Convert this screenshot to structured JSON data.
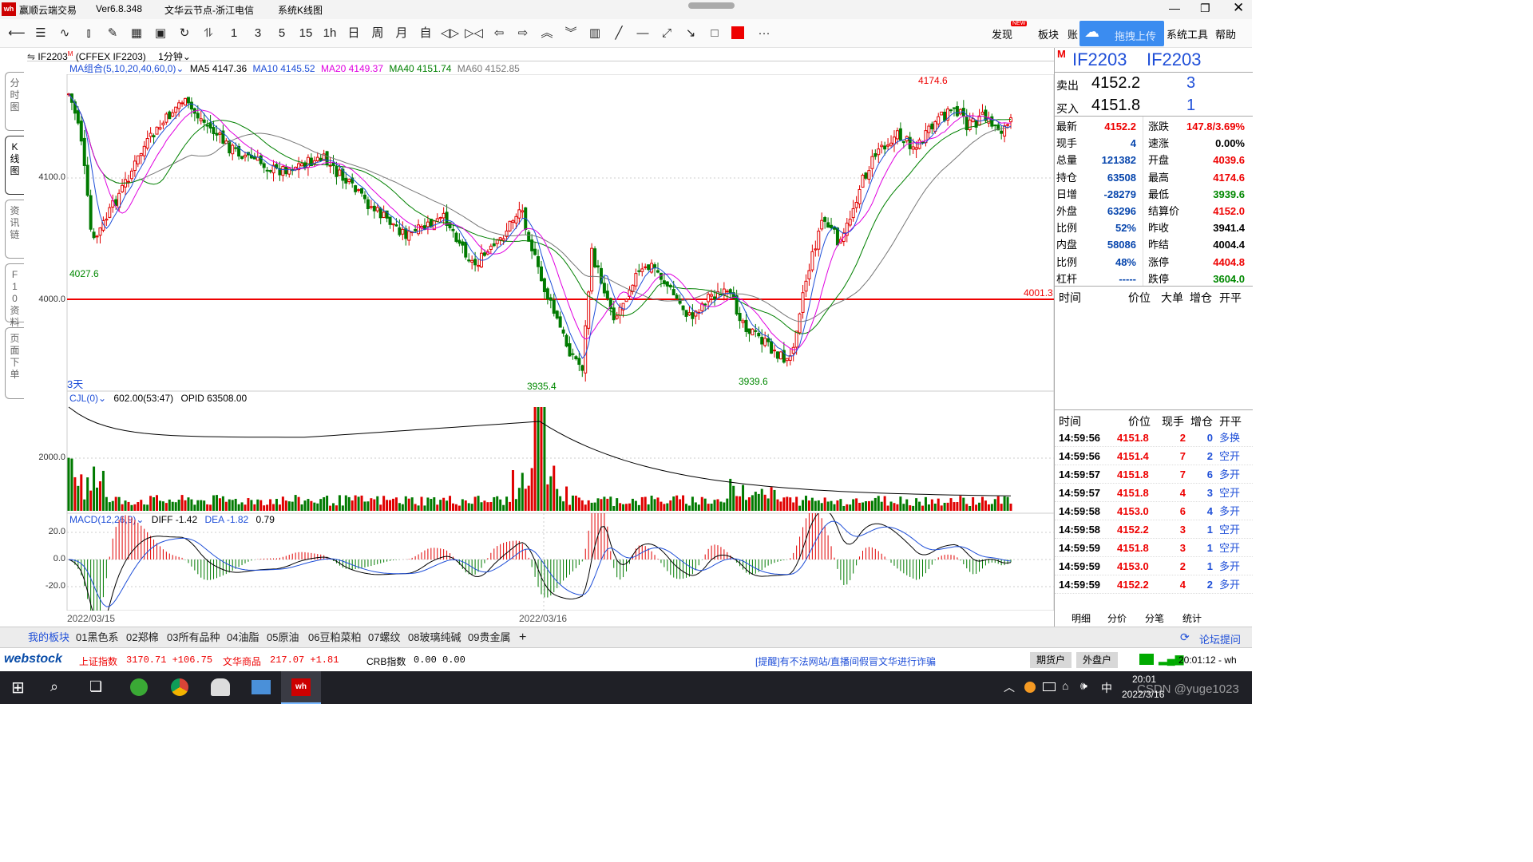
{
  "titlebar": {
    "app": "赢顺云端交易",
    "version": "Ver6.8.348",
    "server": "文华云节点-浙江电信",
    "view": "系统K线图"
  },
  "toolbar": {
    "periods": [
      "1",
      "3",
      "5",
      "15",
      "1h",
      "日",
      "周",
      "月",
      "自"
    ],
    "right_menu": [
      "发现",
      "板块",
      "账",
      "拖拽上传",
      "系统工具",
      "帮助"
    ],
    "new_badge": "NEW"
  },
  "chart_header": {
    "symbol": "IF2203",
    "market_flag": "M",
    "exchange": "(CFFEX IF2203)",
    "period": "1分钟"
  },
  "ma": {
    "label": "MA组合(5,10,20,40,60,0)",
    "ma5": "MA5 4147.36",
    "ma10": "MA10 4145.52",
    "ma20": "MA20 4149.37",
    "ma40": "MA40 4151.74",
    "ma60": "MA60 4152.85"
  },
  "price_axis": [
    "4100.0",
    "4000.0"
  ],
  "annotations": {
    "high": "4174.6",
    "low1": "4027.6",
    "low2": "3935.4",
    "low3": "3939.6",
    "hline": "4001.3",
    "days": "3天"
  },
  "volume": {
    "label": "CJL(0)",
    "value": "602.00(53:47)",
    "opid": "OPID 63508.00",
    "axis": "2000.0"
  },
  "macd": {
    "label": "MACD(12,26,9)",
    "diff": "DIFF -1.42",
    "dea": "DEA -1.82",
    "val": "0.79",
    "axis": [
      "20.0",
      "0.0",
      "-20.0"
    ]
  },
  "dates": [
    "2022/03/15",
    "2022/03/16"
  ],
  "sidetabs": [
    "分时图",
    "K线图",
    "资讯链",
    "F10资料",
    "页面下单"
  ],
  "quote": {
    "symbol": "IF2203",
    "symbol2": "IF2203",
    "flag": "M",
    "ask_label": "卖出",
    "ask": "4152.2",
    "ask_vol": "3",
    "bid_label": "买入",
    "bid": "4151.8",
    "bid_vol": "1",
    "rows": [
      {
        "l1": "最新",
        "v1": "4152.2",
        "c1": "#e00",
        "l2": "涨跌",
        "v2": "147.8/3.69%",
        "c2": "#e00"
      },
      {
        "l1": "现手",
        "v1": "4",
        "c1": "#0645ad",
        "l2": "速涨",
        "v2": "0.00%",
        "c2": "#000"
      },
      {
        "l1": "总量",
        "v1": "121382",
        "c1": "#0645ad",
        "l2": "开盘",
        "v2": "4039.6",
        "c2": "#e00"
      },
      {
        "l1": "持仓",
        "v1": "63508",
        "c1": "#0645ad",
        "l2": "最高",
        "v2": "4174.6",
        "c2": "#e00"
      },
      {
        "l1": "日增",
        "v1": "-28279",
        "c1": "#0645ad",
        "l2": "最低",
        "v2": "3939.6",
        "c2": "#080"
      },
      {
        "l1": "外盘",
        "v1": "63296",
        "c1": "#0645ad",
        "l2": "结算价",
        "v2": "4152.0",
        "c2": "#e00"
      },
      {
        "l1": "比例",
        "v1": "52%",
        "c1": "#0645ad",
        "l2": "昨收",
        "v2": "3941.4",
        "c2": "#000"
      },
      {
        "l1": "内盘",
        "v1": "58086",
        "c1": "#0645ad",
        "l2": "昨结",
        "v2": "4004.4",
        "c2": "#000"
      },
      {
        "l1": "比例",
        "v1": "48%",
        "c1": "#0645ad",
        "l2": "涨停",
        "v2": "4404.8",
        "c2": "#e00"
      },
      {
        "l1": "杠杆",
        "v1": "-----",
        "c1": "#0645ad",
        "l2": "跌停",
        "v2": "3604.0",
        "c2": "#080"
      }
    ],
    "col_headers": [
      "时间",
      "价位",
      "大单",
      "增仓",
      "开平"
    ],
    "ticks_headers": [
      "时间",
      "价位",
      "现手",
      "增仓",
      "开平"
    ],
    "ticks": [
      {
        "t": "14:59:56",
        "p": "4151.8",
        "v": "2",
        "d": "0",
        "k": "多换"
      },
      {
        "t": "14:59:56",
        "p": "4151.4",
        "v": "7",
        "d": "2",
        "k": "空开"
      },
      {
        "t": "14:59:57",
        "p": "4151.8",
        "v": "7",
        "d": "6",
        "k": "多开"
      },
      {
        "t": "14:59:57",
        "p": "4151.8",
        "v": "4",
        "d": "3",
        "k": "空开"
      },
      {
        "t": "14:59:58",
        "p": "4153.0",
        "v": "6",
        "d": "4",
        "k": "多开"
      },
      {
        "t": "14:59:58",
        "p": "4152.2",
        "v": "3",
        "d": "1",
        "k": "空开"
      },
      {
        "t": "14:59:59",
        "p": "4151.8",
        "v": "3",
        "d": "1",
        "k": "空开"
      },
      {
        "t": "14:59:59",
        "p": "4153.0",
        "v": "2",
        "d": "1",
        "k": "多开"
      },
      {
        "t": "14:59:59",
        "p": "4152.2",
        "v": "4",
        "d": "2",
        "k": "多开"
      }
    ],
    "bottom_tabs": [
      "明细",
      "分价",
      "分笔",
      "统计"
    ]
  },
  "board_tabs": [
    "我的板块",
    "01黑色系",
    "02郑棉",
    "03所有品种",
    "04油脂",
    "05原油",
    "06豆粕菜粕",
    "07螺纹",
    "08玻璃纯碱",
    "09贵金属",
    "+"
  ],
  "forum": "论坛提问",
  "status": {
    "logo": "webstock",
    "idx1_name": "上证指数",
    "idx1": "3170.71 +106.75",
    "idx2_name": "文华商品",
    "idx2": "217.07 +1.81",
    "idx3_name": "CRB指数",
    "idx3": "0.00 0.00",
    "notice": "[提醒]有不法网站/直播间假冒文华进行诈骗",
    "btn1": "期货户",
    "btn2": "外盘户",
    "clock": "20:01:12 - wh"
  },
  "taskbar": {
    "time": "20:01",
    "date": "2022/3/16",
    "ime": "中",
    "watermark": "CSDN @yuge1023"
  },
  "colors": {
    "up": "#e00000",
    "down": "#007a00",
    "ma5": "#000000",
    "ma10": "#1f4fd8",
    "ma20": "#e000e0",
    "ma40": "#008000",
    "ma60": "#777777",
    "hline": "#e00000"
  }
}
